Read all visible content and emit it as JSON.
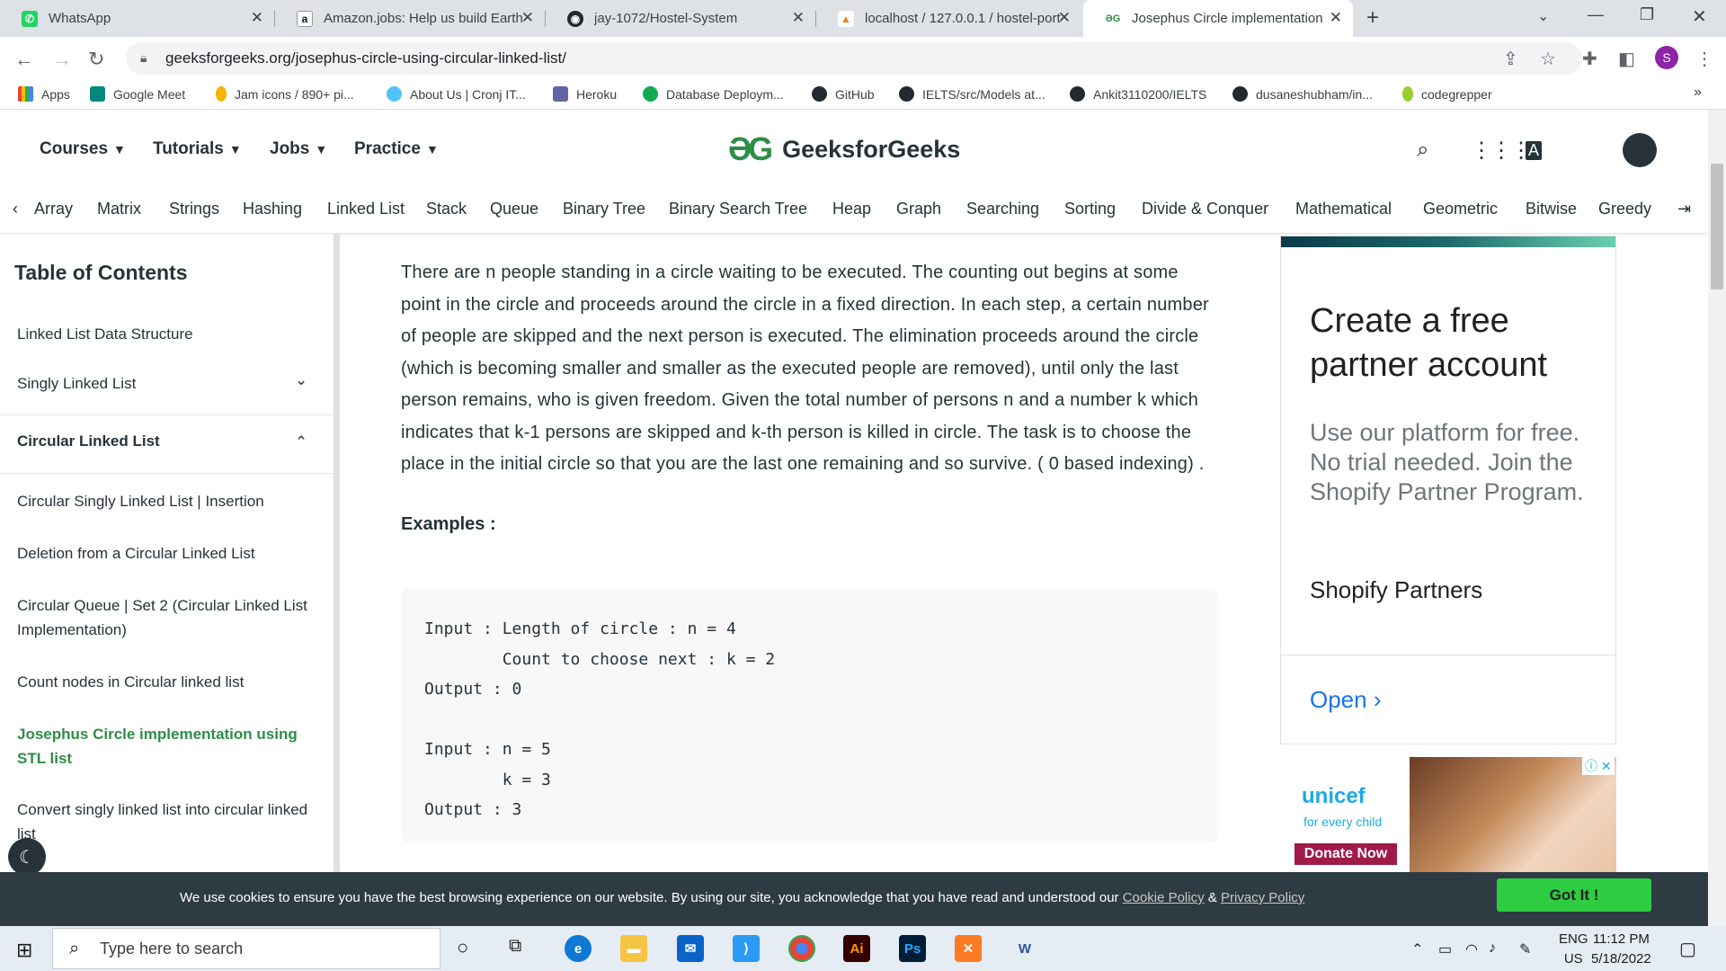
{
  "browser": {
    "tabs": [
      {
        "title": "WhatsApp",
        "icon": "whatsapp-icon",
        "color": "#25d366",
        "glyph": "✆"
      },
      {
        "title": "Amazon.jobs: Help us build Earth",
        "icon": "amazon-icon",
        "color": "#111111",
        "glyph": "a"
      },
      {
        "title": "jay-1072/Hostel-System",
        "icon": "github-icon",
        "color": "#24292f",
        "glyph": "◉"
      },
      {
        "title": "localhost / 127.0.0.1 / hostel-port",
        "icon": "phpmyadmin-icon",
        "color": "#e67e22",
        "glyph": "▲"
      },
      {
        "title": "Josephus Circle implementation",
        "icon": "gfg-icon",
        "color": "#2f8d46",
        "glyph": "ƏG"
      }
    ],
    "url": "geeksforgeeks.org/josephus-circle-using-circular-linked-list/",
    "profile_initial": "S"
  },
  "bookmarks": [
    {
      "label": "Apps",
      "color": "#4285f4"
    },
    {
      "label": "Google Meet",
      "color": "#00897b"
    },
    {
      "label": "Jam icons / 890+ pi...",
      "color": "#f4b400"
    },
    {
      "label": "About Us | Cronj IT...",
      "color": "#4fc3f7"
    },
    {
      "label": "Heroku",
      "color": "#6762a6"
    },
    {
      "label": "Database Deploym...",
      "color": "#13aa52"
    },
    {
      "label": "GitHub",
      "color": "#24292f"
    },
    {
      "label": "IELTS/src/Models at...",
      "color": "#24292f"
    },
    {
      "label": "Ankit3110200/IELTS",
      "color": "#24292f"
    },
    {
      "label": "dusaneshubham/in...",
      "color": "#24292f"
    },
    {
      "label": "codegrepper",
      "color": "#9acd32"
    }
  ],
  "site": {
    "nav": [
      "Courses",
      "Tutorials",
      "Jobs",
      "Practice"
    ],
    "logo_mark": "ƏG",
    "logo_text": "GeeksforGeeks",
    "topics": [
      "Array",
      "Matrix",
      "Strings",
      "Hashing",
      "Linked List",
      "Stack",
      "Queue",
      "Binary Tree",
      "Binary Search Tree",
      "Heap",
      "Graph",
      "Searching",
      "Sorting",
      "Divide & Conquer",
      "Mathematical",
      "Geometric",
      "Bitwise",
      "Greedy"
    ]
  },
  "sidebar": {
    "title": "Table of Contents",
    "items": [
      {
        "label": "Linked List Data Structure"
      },
      {
        "label": "Singly Linked List"
      },
      {
        "label": "Circular Linked List"
      },
      {
        "label": "Circular Singly Linked List | Insertion"
      },
      {
        "label": "Deletion from a Circular Linked List"
      },
      {
        "label": "Circular Queue | Set 2 (Circular Linked List Implementation)"
      },
      {
        "label": "Count nodes in Circular linked list"
      },
      {
        "label": "Josephus Circle implementation using STL list"
      },
      {
        "label": "Convert singly linked list into circular linked list"
      }
    ]
  },
  "article": {
    "paragraph": "There are n people standing in a circle waiting to be executed. The counting out begins at some point in the circle and proceeds around the circle in a fixed direction. In each step, a certain number of people are skipped and the next person is executed. The elimination proceeds around the circle (which is becoming smaller and smaller as the executed people are removed), until only the last person remains, who is given freedom. Given the total number of persons n and a number k which indicates that k-1 persons are skipped and k-th person is killed in circle. The task is to choose the place in the initial circle so that you are the last one remaining and so survive. ( 0 based indexing) .",
    "examples_label": "Examples :",
    "code_lines": [
      "Input : Length of circle : n = 4",
      "        Count to choose next : k = 2",
      "Output : 0",
      "",
      "Input : n = 5",
      "        k = 3",
      "Output : 3"
    ]
  },
  "ad": {
    "headline": "Create a free partner account",
    "body": "Use our platform for free. No trial needed. Join the Shopify Partner Program.",
    "brand": "Shopify Partners",
    "cta": "Open",
    "unicef_logo": "unicef",
    "unicef_tagline": "for every child",
    "unicef_cta": "Donate Now"
  },
  "cookie": {
    "message": "We use cookies to ensure you have the best browsing experience on our website. By using our site, you acknowledge that you have read and understood our",
    "cookie_policy": "Cookie Policy",
    "amp": "&",
    "privacy_policy": "Privacy Policy",
    "button": "Got It !"
  },
  "taskbar": {
    "search_placeholder": "Type here to search",
    "lang_top": "ENG",
    "lang_bottom": "US",
    "time": "11:12 PM",
    "date": "5/18/2022"
  }
}
